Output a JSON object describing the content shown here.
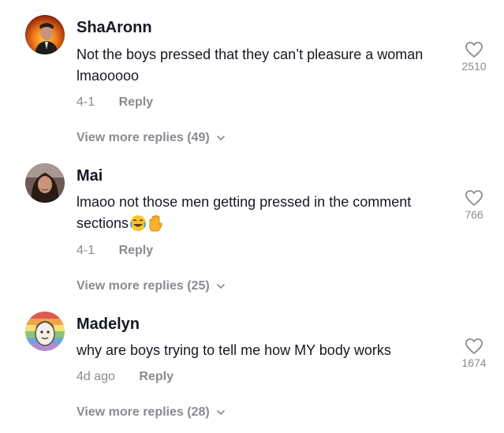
{
  "comments": [
    {
      "username": "ShaAronn",
      "text": "Not the boys pressed that they can’t pleasure a woman lmaooooo",
      "date": "4-1",
      "reply_label": "Reply",
      "likes": "2510",
      "view_more": "View more replies (49)"
    },
    {
      "username": "Mai",
      "text": "lmaoo not those men getting pressed in the comment sections",
      "emojis": [
        "face-with-tears-of-joy",
        "raised-hand"
      ],
      "date": "4-1",
      "reply_label": "Reply",
      "likes": "766",
      "view_more": "View more replies (25)"
    },
    {
      "username": "Madelyn",
      "text": "why are boys trying to tell me how MY body works",
      "date": "4d ago",
      "reply_label": "Reply",
      "likes": "1674",
      "view_more": "View more replies (28)"
    }
  ],
  "icons": {
    "like": "heart-outline-icon",
    "expand": "chevron-down-icon"
  },
  "colors": {
    "text": "#161823",
    "muted": "#8a8b91",
    "background": "#ffffff"
  }
}
